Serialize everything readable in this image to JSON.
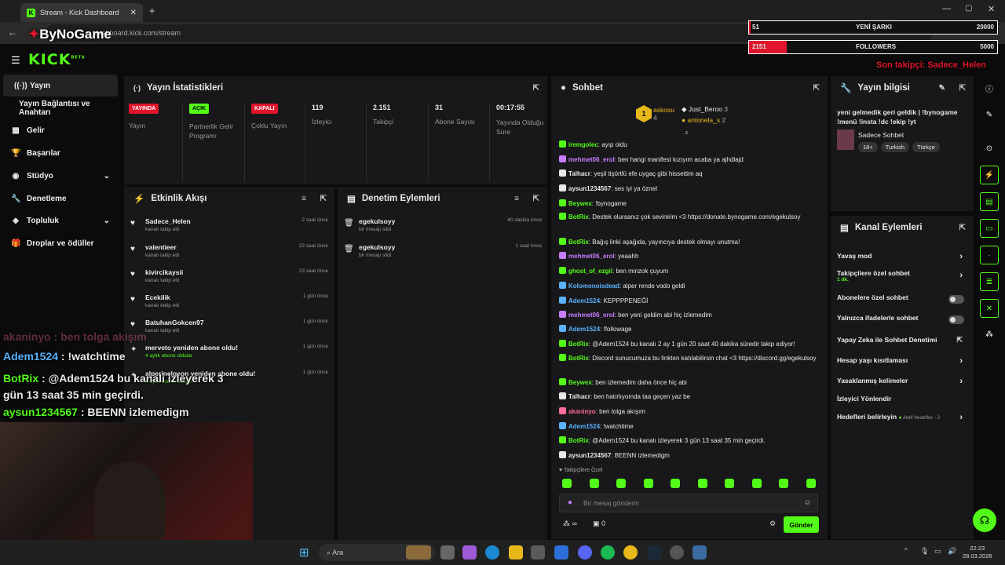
{
  "browser": {
    "tab_title": "Stream - Kick Dashboard",
    "url": "dashboard.kick.com/stream"
  },
  "overlay": {
    "logo": "ByNoGame",
    "song_value": "51",
    "song_label": "YENİ ŞARKI",
    "song_goal": "20000",
    "fol_value": "2151",
    "fol_label": "FOLLOWERS",
    "fol_goal": "5000",
    "last_follower": "Son takipçi: Sadece_Helen"
  },
  "kick": {
    "logo": "KICK",
    "beta": "BETA"
  },
  "sidebar": {
    "items": [
      "Yayın",
      "Yayın Bağlantısı ve Anahtarı",
      "Gelir",
      "Başarılar",
      "Stüdyo",
      "Denetleme",
      "Topluluk",
      "Droplar ve ödüller"
    ]
  },
  "stats": {
    "title": "Yayın İstatistikleri",
    "cols": [
      {
        "badge": "YAYINDA",
        "label": "Yayın"
      },
      {
        "badge": "AÇIK",
        "label": "Partnerlik Gelir Programı"
      },
      {
        "badge": "KAPALI",
        "label": "Çoklu Yayın"
      },
      {
        "value": "119",
        "label": "İzleyici"
      },
      {
        "value": "2.151",
        "label": "Takipçi"
      },
      {
        "value": "31",
        "label": "Abone Sayısı"
      },
      {
        "value": "00:17:55",
        "label": "Yayında Olduğu Süre"
      }
    ]
  },
  "activity": {
    "title": "Etkinlik Akışı",
    "rows": [
      {
        "name": "Sadece_Helen",
        "sub": "kanalı takip etti",
        "time": "2 saat önce"
      },
      {
        "name": "valentieer",
        "sub": "kanalı takip etti",
        "time": "22 saat önce"
      },
      {
        "name": "kivircikaysii",
        "sub": "kanalı takip etti",
        "time": "23 saat önce"
      },
      {
        "name": "Ecekilik",
        "sub": "kanalı takip etti",
        "time": "1 gün önce"
      },
      {
        "name": "BatuhanGokcen97",
        "sub": "kanalı takip etti",
        "time": "1 gün önce"
      },
      {
        "name": "merveto yeniden abone oldu!",
        "sub": "4 aylık abone oldular",
        "time": "1 gün önce"
      },
      {
        "name": "alperinelqeon yeniden abone oldu!",
        "sub": "6 aylık abone oldular",
        "time": "1 gün önce"
      }
    ]
  },
  "moderation": {
    "title": "Denetim Eylemleri",
    "rows": [
      {
        "name": "egekulsoyy",
        "sub": "bir mesajı sildi",
        "time": "40 dakika önce"
      },
      {
        "name": "egekulsoyy",
        "sub": "bir mesajı sildi",
        "time": "1 saat önce"
      }
    ]
  },
  "chat": {
    "title": "Sohbet",
    "top1": "askosu",
    "top1_count": "4",
    "top2": "Just_Beroo",
    "top2_count": "3",
    "top3": "antonela_s",
    "top3_count": "2",
    "lines": [
      {
        "u": "iremgolec",
        "c": "#53fc18",
        "t": "ayıp oldu"
      },
      {
        "u": "mehmet06_erol",
        "c": "#c77dff",
        "t": "ben hangi manifest kızıyım acaba ya ajhdlajd"
      },
      {
        "u": "Talhacr",
        "c": "#e8e8e8",
        "t": "yeşil tişörtlü efe uygaç gibi hissettim aq"
      },
      {
        "u": "aysun1234567",
        "c": "#e8e8e8",
        "t": "ses iyi ya öznel"
      },
      {
        "u": "Beywex",
        "c": "#53fc18",
        "t": "!bynogame"
      },
      {
        "u": "BotRix",
        "c": "#53fc18",
        "t": "Destek olursanız çok sevinirim <3 https://donate.bynogame.com/egekulsoy"
      },
      {
        "u": "BotRix",
        "c": "#53fc18",
        "t": "Bağış linki aşağıda, yayıncıya destek olmayı unutma!"
      },
      {
        "u": "mehmet06_erol",
        "c": "#c77dff",
        "t": "yeaahh"
      },
      {
        "u": "ghost_of_ezgii",
        "c": "#53fc18",
        "t": "ben minzok çuyum"
      },
      {
        "u": "Kolomonoisdead",
        "c": "#59b3ff",
        "t": "alper rende vodo geldi"
      },
      {
        "u": "Adem1524",
        "c": "#59b3ff",
        "t": "KEPPPPENEĞİ"
      },
      {
        "u": "mehmet06_erol",
        "c": "#c77dff",
        "t": "ben yeni geldim abi hiç izlemedim"
      },
      {
        "u": "Adem1524",
        "c": "#59b3ff",
        "t": "!followage"
      },
      {
        "u": "BotRix",
        "c": "#53fc18",
        "t": "@Adem1524 bu kanalı 2 ay 1 gün 20 saat 40 dakika süredir takip ediyor!"
      },
      {
        "u": "BotRix",
        "c": "#53fc18",
        "t": "Discord sunucumuza bu linkten katılabilirsin chat <3 https://discord.gg/egekulsoy"
      },
      {
        "u": "Beywex",
        "c": "#53fc18",
        "t": "ben izlemedim daha önce hiç abi"
      },
      {
        "u": "Talhacr",
        "c": "#e8e8e8",
        "t": "ben hatırlıyomda taa geçen yaz be"
      },
      {
        "u": "akaninyo",
        "c": "#ff6b9d",
        "t": "ben tolga akışım"
      },
      {
        "u": "Adem1524",
        "c": "#59b3ff",
        "t": "!watchtime"
      },
      {
        "u": "BotRix",
        "c": "#53fc18",
        "t": "@Adem1524 bu kanalı izleyerek 3 gün 13 saat 35 min geçirdi."
      },
      {
        "u": "aysun1234567",
        "c": "#e8e8e8",
        "t": "BEENN izlemedigm"
      }
    ],
    "followers_only": "Takipçilere Özel",
    "placeholder": "Bir mesaj gönderin",
    "send": "Gönder",
    "infinity": "∞",
    "count": "0"
  },
  "info": {
    "title": "Yayın bilgisi",
    "stream_title": "yeni gelmedik geri geldik | !bynogame !menü !insta !dc !ekip !yt",
    "category": "Sadece Sohbet",
    "tags": [
      "18+",
      "Turkish",
      "Türkçe"
    ]
  },
  "actions": {
    "title": "Kanal Eylemleri",
    "rows": [
      {
        "label": "Yavaş mod",
        "ctrl": "chev"
      },
      {
        "label": "Takipçilere özel sohbet",
        "sub": "1 dk.",
        "ctrl": "chev"
      },
      {
        "label": "Abonelere özel sohbet",
        "ctrl": "tog"
      },
      {
        "label": "Yalnızca ifadelerle sohbet",
        "ctrl": "tog"
      },
      {
        "label": "Yapay Zeka ile Sohbet Denetimi",
        "ctrl": "ext"
      },
      {
        "label": "Hesap yaşı kısıtlaması",
        "ctrl": "chev"
      },
      {
        "label": "Yasaklanmış kelimeler",
        "ctrl": "chev"
      },
      {
        "label": "İzleyici Yönlendir",
        "ctrl": "none"
      },
      {
        "label": "Hedefleri belirleyin",
        "sub": "Aktif hedefler - 2",
        "ctrl": "chev"
      }
    ]
  },
  "stream_overlay_chat": [
    {
      "u": "akaninyo",
      "t": "ben tolga akışım"
    },
    {
      "u": "Adem1524",
      "t": "!watchtime"
    },
    {
      "u": "BotRix",
      "t": "@Adem1524 bu kanalı izleyerek 3 gün 13 saat 35 min geçirdi."
    },
    {
      "u": "aysun1234567",
      "t": "BEENN izlemedigm"
    }
  ],
  "taskbar": {
    "search": "Ara",
    "time": "22:23",
    "date": "28.03.2026"
  },
  "colors": {
    "kick_green": "#53fc18",
    "live_red": "#e0152b"
  }
}
